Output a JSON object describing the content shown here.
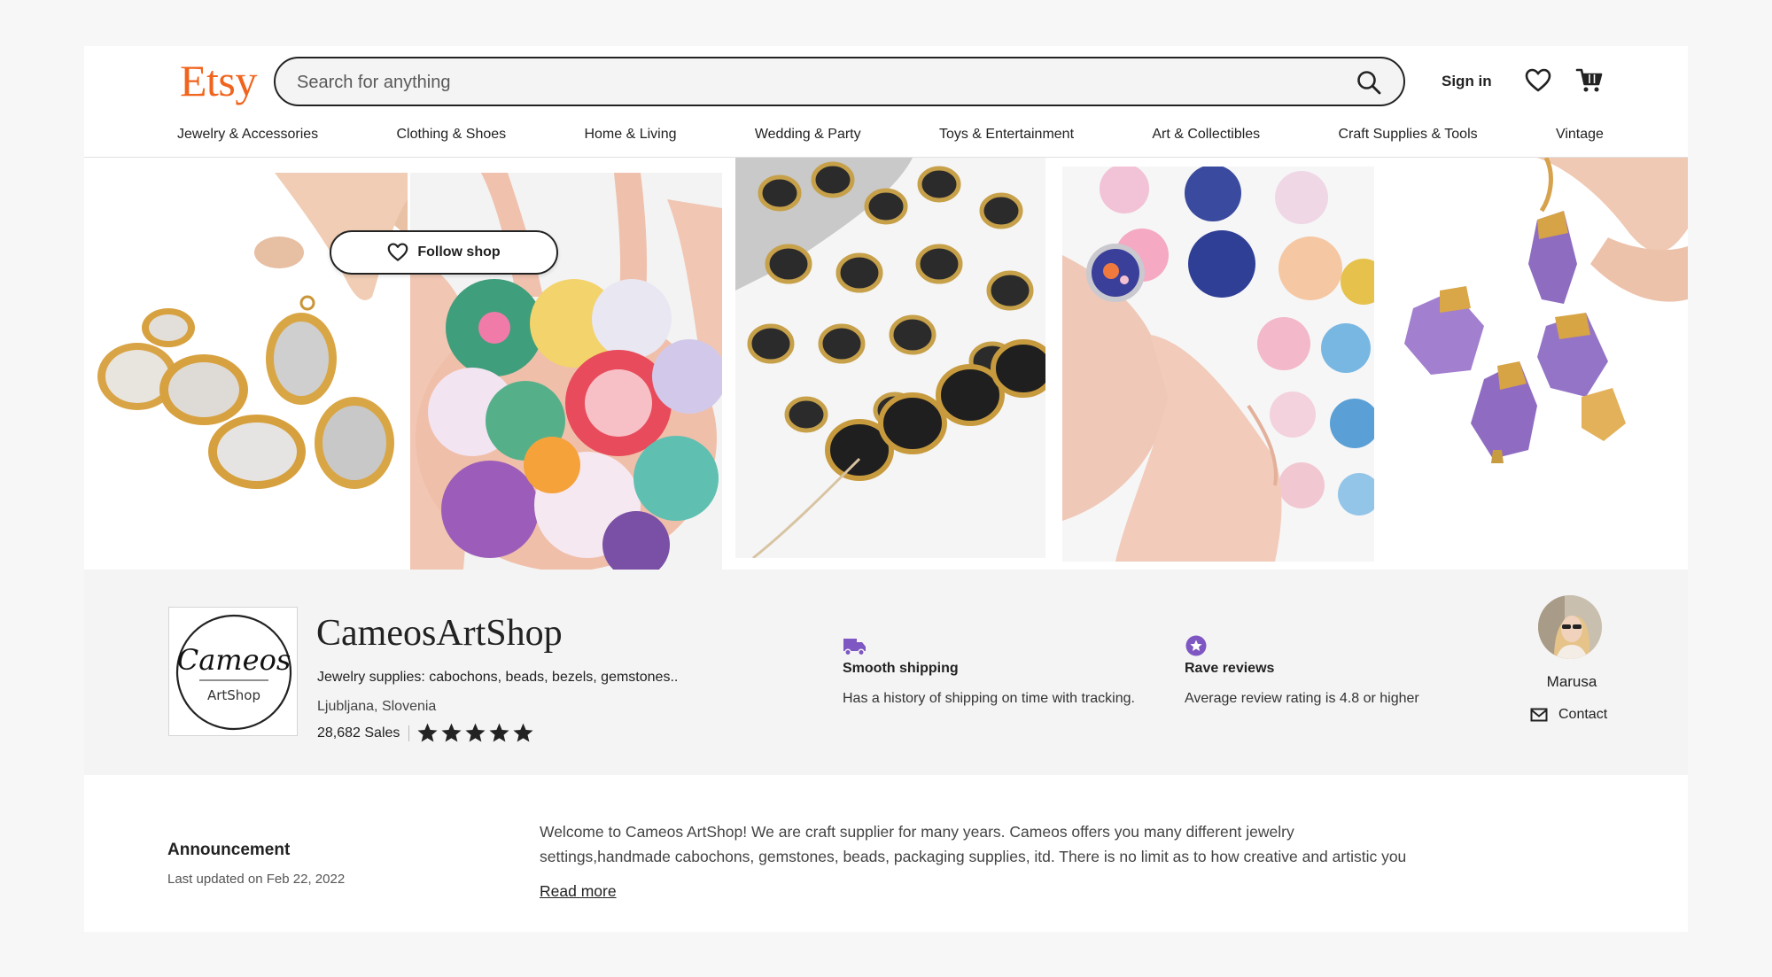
{
  "header": {
    "logo": "Etsy",
    "search_placeholder": "Search for anything",
    "signin": "Sign in",
    "categories": [
      "Jewelry & Accessories",
      "Clothing & Shoes",
      "Home & Living",
      "Wedding & Party",
      "Toys & Entertainment",
      "Art & Collectibles",
      "Craft Supplies & Tools",
      "Vintage"
    ]
  },
  "banner": {
    "photos": [
      "druzy-pendants-photo",
      "cabochons-in-hands-photo",
      "striped-beads-photo",
      "ring-cabochon-photo",
      "amethyst-pendants-photo"
    ]
  },
  "shop": {
    "logo_script": "Cameos",
    "logo_sub": "ArtShop",
    "name": "CameosArtShop",
    "tagline": "Jewelry supplies: cabochons, beads, bezels, gemstones..",
    "location": "Ljubljana, Slovenia",
    "sales": "28,682 Sales",
    "rating": 5,
    "follow_label": "Follow shop",
    "features": [
      {
        "title": "Smooth shipping",
        "desc": "Has a history of shipping on time with tracking.",
        "icon": "truck-icon"
      },
      {
        "title": "Rave reviews",
        "desc": "Average review rating is 4.8 or higher",
        "icon": "star-badge-icon"
      }
    ],
    "owner": {
      "name": "Marusa",
      "contact_label": "Contact"
    }
  },
  "announcement": {
    "title": "Announcement",
    "updated": "Last updated on Feb 22, 2022",
    "line1": "Welcome to Cameos ArtShop! We are craft supplier for many years. Cameos offers you many different jewelry",
    "line2": "settings,handmade cabochons, gemstones, beads, packaging supplies, itd. There is no limit as to how creative and artistic you",
    "read_more": "Read more"
  },
  "colors": {
    "brand": "#f1641e",
    "feature_icon": "#7e57c2",
    "text": "#222222"
  }
}
